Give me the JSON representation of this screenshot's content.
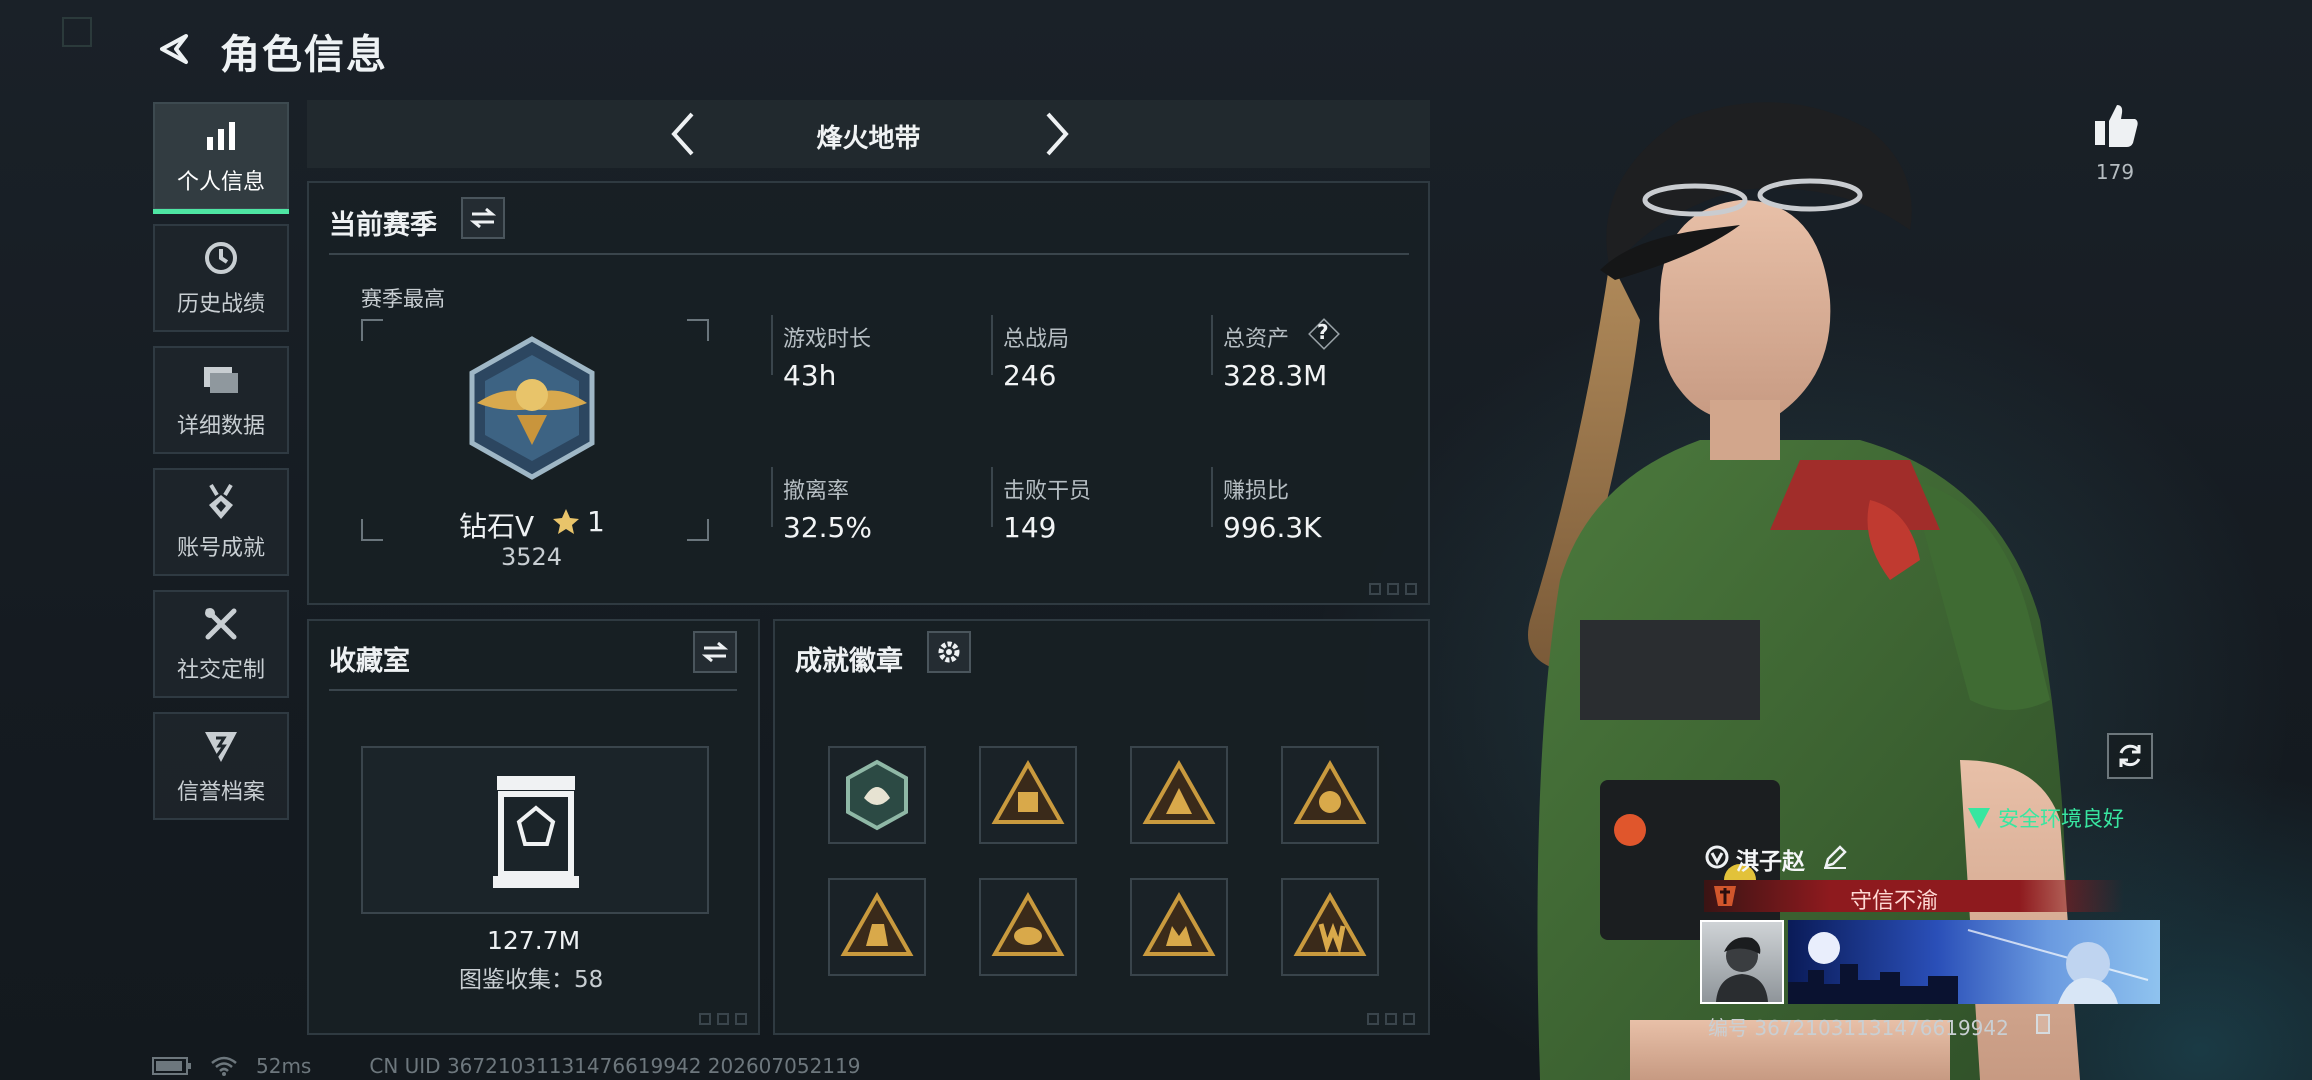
{
  "header": {
    "title": "角色信息"
  },
  "sidebar": {
    "items": [
      {
        "label": "个人信息",
        "icon": "bar-chart-icon",
        "active": true
      },
      {
        "label": "历史战绩",
        "icon": "clock-icon",
        "active": false
      },
      {
        "label": "详细数据",
        "icon": "stack-icon",
        "active": false
      },
      {
        "label": "账号成就",
        "icon": "medal-icon",
        "active": false
      },
      {
        "label": "社交定制",
        "icon": "tools-icon",
        "active": false
      },
      {
        "label": "信誉档案",
        "icon": "shield-icon",
        "active": false
      }
    ]
  },
  "mode": {
    "name": "烽火地带"
  },
  "season": {
    "title": "当前赛季",
    "best_label": "赛季最高",
    "rank_name": "钻石V",
    "rank_stars": "1",
    "rank_points": "3524",
    "stats": [
      {
        "label": "游戏时长",
        "value": "43h"
      },
      {
        "label": "总战局",
        "value": "246"
      },
      {
        "label": "总资产",
        "value": "328.3M",
        "help": "?"
      },
      {
        "label": "撤离率",
        "value": "32.5%"
      },
      {
        "label": "击败干员",
        "value": "149"
      },
      {
        "label": "赚损比",
        "value": "996.3K"
      }
    ]
  },
  "collection": {
    "title": "收藏室",
    "value": "127.7M",
    "count_text": "图鉴收集：58"
  },
  "achievements": {
    "title": "成就徽章",
    "badges": [
      "hexagon-badge-icon",
      "triangle-badge-icon",
      "triangle-badge-icon",
      "triangle-badge-icon",
      "triangle-badge-icon",
      "triangle-badge-icon",
      "triangle-badge-icon",
      "triangle-badge-icon"
    ]
  },
  "profile": {
    "likes": "179",
    "env_status": "安全环境良好",
    "player_name": "淇子赵",
    "player_title": "守信不渝",
    "uid_right": "编号 36721031131476619942"
  },
  "status_bar": {
    "ping": "52ms",
    "uid": "CN UID 36721031131476619942 202607052119"
  },
  "colors": {
    "accent": "#4ee5a3",
    "title_red": "#8e1a1e",
    "env_green": "#38e6a0"
  }
}
